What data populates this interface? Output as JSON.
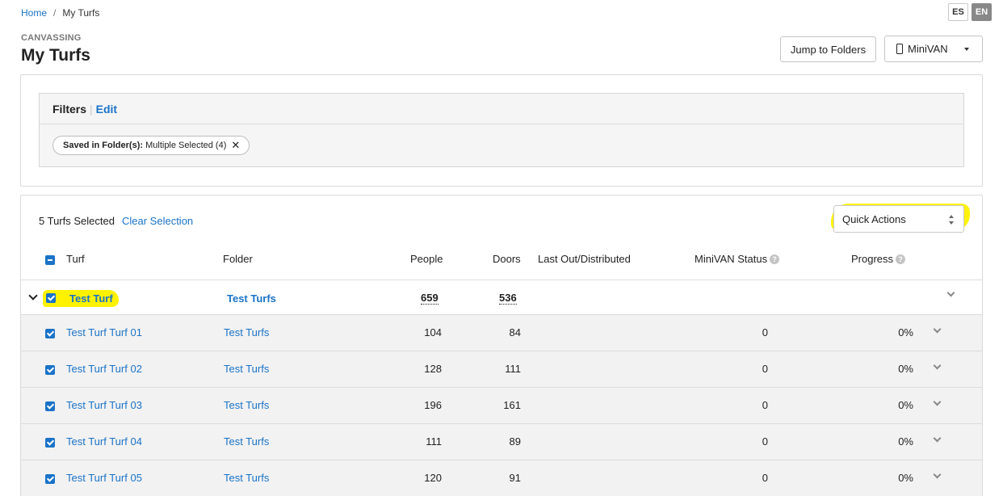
{
  "breadcrumb": {
    "home": "Home",
    "separator": "/",
    "current": "My Turfs"
  },
  "language": {
    "es": "ES",
    "en": "EN",
    "active": "EN"
  },
  "header": {
    "section": "CANVASSING",
    "title": "My Turfs",
    "jump_button": "Jump to Folders",
    "minivan_button": "MiniVAN"
  },
  "filters": {
    "label": "Filters",
    "edit": "Edit",
    "chip_key": "Saved in Folder(s):",
    "chip_value": "Multiple Selected (4)",
    "chip_close": "✕"
  },
  "table": {
    "selection_text": "5 Turfs Selected",
    "clear_selection": "Clear Selection",
    "quick_actions": "Quick Actions",
    "columns": {
      "turf": "Turf",
      "folder": "Folder",
      "people": "People",
      "doors": "Doors",
      "last_out": "Last Out/Distributed",
      "minivan_status": "MiniVAN Status",
      "progress": "Progress"
    },
    "group": {
      "turf": "Test Turf",
      "folder": "Test Turfs",
      "people": "659",
      "doors": "536"
    },
    "rows": [
      {
        "turf": "Test Turf Turf 01",
        "folder": "Test Turfs",
        "people": "104",
        "doors": "84",
        "minivan_status": "0",
        "progress": "0%"
      },
      {
        "turf": "Test Turf Turf 02",
        "folder": "Test Turfs",
        "people": "128",
        "doors": "111",
        "minivan_status": "0",
        "progress": "0%"
      },
      {
        "turf": "Test Turf Turf 03",
        "folder": "Test Turfs",
        "people": "196",
        "doors": "161",
        "minivan_status": "0",
        "progress": "0%"
      },
      {
        "turf": "Test Turf Turf 04",
        "folder": "Test Turfs",
        "people": "111",
        "doors": "89",
        "minivan_status": "0",
        "progress": "0%"
      },
      {
        "turf": "Test Turf Turf 05",
        "folder": "Test Turfs",
        "people": "120",
        "doors": "91",
        "minivan_status": "0",
        "progress": "0%"
      }
    ]
  },
  "colors": {
    "link": "#1a73c7",
    "highlight": "#fff200",
    "row_bg": "#f2f2f2"
  }
}
